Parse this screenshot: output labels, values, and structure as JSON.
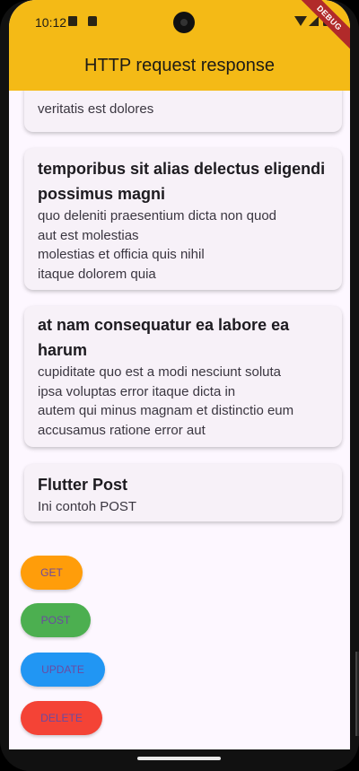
{
  "status_bar": {
    "time": "10:12",
    "debug_label": "DEBUG"
  },
  "app_bar": {
    "title": "HTTP request response",
    "color": "#f4ba16"
  },
  "posts": [
    {
      "title": "",
      "body": "veritatis est dolores"
    },
    {
      "title": "temporibus sit alias delectus eligendi possimus magni",
      "body": "quo deleniti praesentium dicta non quod\naut est molestias\nmolestias et officia quis nihil\nitaque dolorem quia"
    },
    {
      "title": "at nam consequatur ea labore ea harum",
      "body": "cupiditate quo est a modi nesciunt soluta\nipsa voluptas error itaque dicta in\nautem qui minus magnam et distinctio eum\naccusamus ratione error aut"
    },
    {
      "title": "Flutter Post",
      "body": "Ini contoh POST"
    }
  ],
  "buttons": [
    {
      "label": "GET",
      "color": "#ff9d0a"
    },
    {
      "label": "POST",
      "color": "#4caf50"
    },
    {
      "label": "UPDATE",
      "color": "#2196f3"
    },
    {
      "label": "DELETE",
      "color": "#f44336"
    }
  ]
}
